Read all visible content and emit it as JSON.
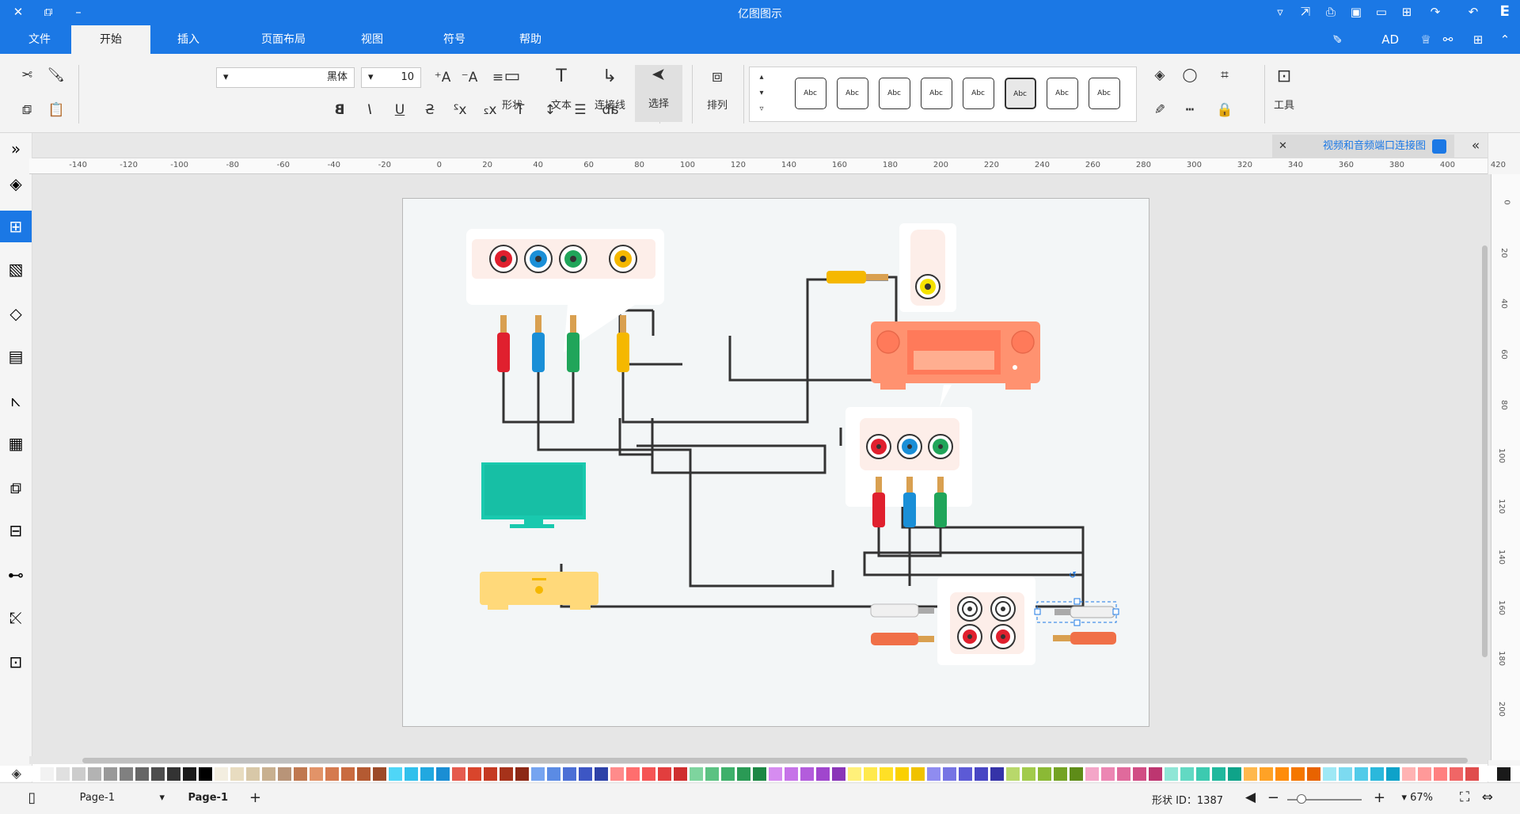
{
  "app": {
    "title": "亿图图示"
  },
  "menu": {
    "tabs": [
      "文件",
      "开始",
      "插入",
      "页面布局",
      "视图",
      "符号",
      "帮助"
    ],
    "active": "开始"
  },
  "ribbon": {
    "font_name": "黑体",
    "font_size": "10",
    "shape_label": "形状",
    "text_label": "文本",
    "connector_label": "连接线",
    "select_label": "选择",
    "arrange_label": "排列",
    "tools_label": "工具",
    "style_sample": "Abc"
  },
  "document": {
    "tab_title": "视频和音频端口连接图"
  },
  "ruler": {
    "h_labels": [
      "-140",
      "-120",
      "-100",
      "-80",
      "-60",
      "-40",
      "-20",
      "0",
      "20",
      "40",
      "60",
      "80",
      "100",
      "120",
      "140",
      "160",
      "180",
      "200",
      "220",
      "240",
      "260",
      "280",
      "300",
      "320",
      "340",
      "360",
      "380",
      "400",
      "420"
    ],
    "v_labels": [
      "0",
      "20",
      "40",
      "60",
      "80",
      "100",
      "120",
      "140",
      "160",
      "180",
      "200"
    ]
  },
  "status": {
    "page_selector": "Page-1",
    "page_tab": "Page-1",
    "shape_id": "形状 ID：1387",
    "zoom": "67%"
  },
  "colors": {
    "accent": "#1b78e5",
    "tv": "#19c9ae",
    "receiver": "#ff9270",
    "player": "#ffd97a",
    "panel": "#fdeee9",
    "red": "#e0202e",
    "blue": "#1a8fd7",
    "green": "#20a55a",
    "yellow": "#f5b800",
    "wire": "#333333"
  },
  "palette": [
    "#ffffff",
    "#f2f2f2",
    "#e0e0e0",
    "#cccccc",
    "#b3b3b3",
    "#999999",
    "#808080",
    "#666666",
    "#4d4d4d",
    "#333333",
    "#1a1a1a",
    "#000000",
    "#f3eee0",
    "#e8dcc0",
    "#d8c8a8",
    "#c8b090",
    "#b89478",
    "#c07850",
    "#e29368",
    "#d57a4f",
    "#c96b40",
    "#b45a32",
    "#9c4a28",
    "#4fd6f7",
    "#31c0ec",
    "#21a8e0",
    "#1a8ed4",
    "#e55b4e",
    "#d9452c",
    "#c53a22",
    "#a6321a",
    "#8c2815",
    "#76a4f0",
    "#5b8be4",
    "#4b6fd6",
    "#3d56c4",
    "#2e42a8",
    "#ff8b8b",
    "#ff6e6e",
    "#f55555",
    "#e23e3e",
    "#cf2f2f",
    "#7ed49e",
    "#5bc282",
    "#3eb06a",
    "#2a9a55",
    "#1c8744",
    "#d68cf0",
    "#c673e8",
    "#b35cdc",
    "#a046cd",
    "#8a35b8",
    "#fff07a",
    "#ffe94d",
    "#ffe026",
    "#fad000",
    "#f0c200",
    "#8f8cf0",
    "#7674e4",
    "#5c5ad6",
    "#4846c4",
    "#3533a8",
    "#b8d86b",
    "#a2cb4c",
    "#8bb935",
    "#74a324",
    "#5e8c18",
    "#f4a6c8",
    "#ec86b3",
    "#e06a9c",
    "#d14d84",
    "#bd3670",
    "#8fe6d6",
    "#62d9c3",
    "#3ccab0",
    "#20b89d",
    "#0fa389",
    "#ffb84d",
    "#ffa226",
    "#ff8c0a",
    "#f57700",
    "#e86300",
    "#9fe8f5",
    "#7cdaf0",
    "#52cbe9",
    "#2bb8dc",
    "#0ea2c9",
    "#ffb3b3",
    "#ff9999",
    "#ff8080",
    "#f06666",
    "#e04d4d",
    "#ffffff",
    "#1a1a1a"
  ]
}
